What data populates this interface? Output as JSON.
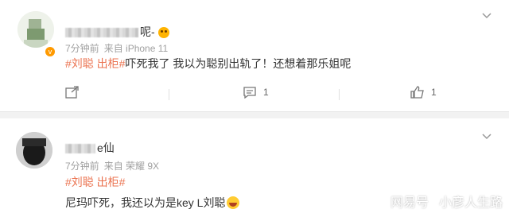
{
  "comments": [
    {
      "username_visible": "呢-",
      "time": "7分钟前",
      "source": "来自 iPhone 11",
      "tag": "#刘聪 出柜#",
      "text": "吓死我了 我以为聪别出轨了！还想着那乐姐呢",
      "reply_icon": "reply-icon",
      "like_icon": "like-icon",
      "reply_count": "1",
      "like_count": "1"
    },
    {
      "username_visible": "e仙",
      "time": "7分钟前",
      "source": "来自 荣耀 9X",
      "tag": "#刘聪 出柜#",
      "text": "尼玛吓死，我还以为是key L刘聪"
    }
  ],
  "watermark": {
    "brand": "网易号",
    "author": "小彦人生路"
  },
  "colors": {
    "tag": "#eb7350",
    "meta": "#a0a0a0",
    "vip_badge": "#ff9a00"
  }
}
